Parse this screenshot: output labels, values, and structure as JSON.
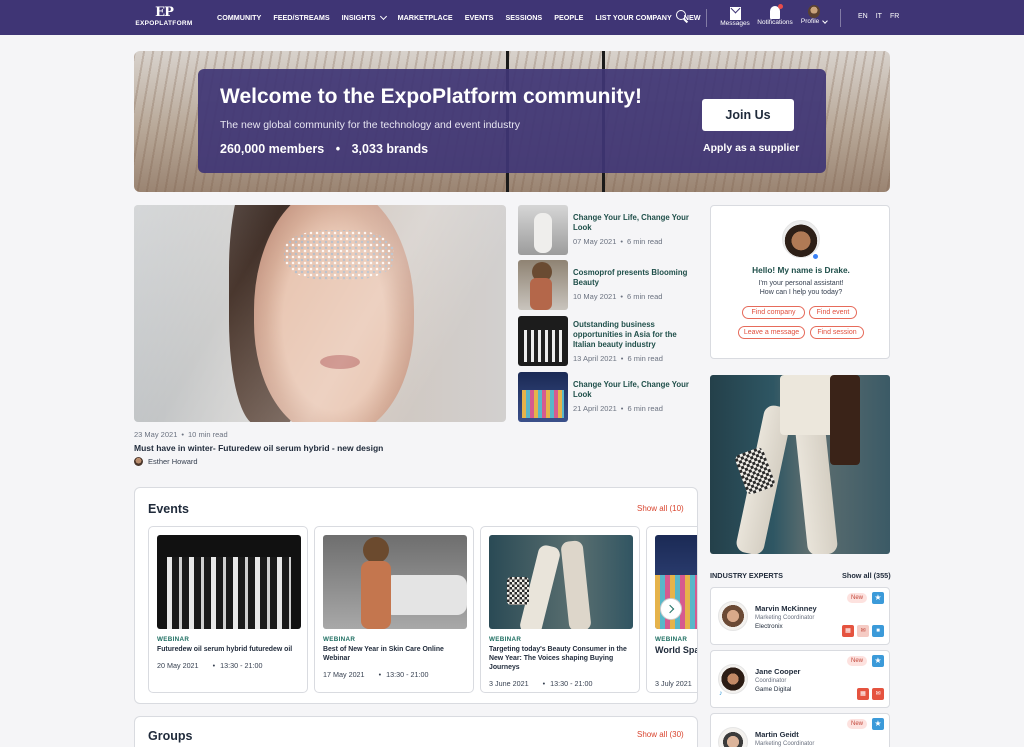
{
  "nav": {
    "logo_mark": "EP",
    "logo_text": "EXPOPLATFORM",
    "menu": [
      "COMMUNITY",
      "FEED/STREAMS",
      "INSIGHTS",
      "MARKETPLACE",
      "EVENTS",
      "SESSIONS",
      "PEOPLE",
      "LIST YOUR COMPANY",
      "NEW"
    ],
    "messages": "Messages",
    "notifications": "Notifications",
    "profile": "Profile",
    "langs": [
      "EN",
      "IT",
      "FR"
    ]
  },
  "hero": {
    "title": "Welcome to the ExpoPlatform community!",
    "subtitle": "The new global community for the technology and event industry",
    "members": "260,000 members",
    "brands": "3,033 brands",
    "join": "Join Us",
    "supplier": "Apply as a supplier"
  },
  "featured": {
    "date": "23 May 2021",
    "read": "10 min read",
    "title": "Must have in winter- Futuredew oil serum hybrid - new design",
    "author": "Esther Howard"
  },
  "articles": [
    {
      "title": "Change Your Life, Change Your Look",
      "date": "07 May 2021",
      "read": "6 min read"
    },
    {
      "title": "Cosmoprof presents Blooming Beauty",
      "date": "10 May 2021",
      "read": "6 min read"
    },
    {
      "title": "Outstanding business opportunities in Asia for the Italian beauty industry",
      "date": "13 April 2021",
      "read": "6 min read"
    },
    {
      "title": "Change Your Life, Change Your Look",
      "date": "21 April 2021",
      "read": "6 min read"
    }
  ],
  "assistant": {
    "hello": "Hello! My name is Drake.",
    "line1": "I'm your personal assistant!",
    "line2": "How can I help you today?",
    "find_company": "Find company",
    "find_event": "Find event",
    "leave_message": "Leave a message",
    "find_session": "Find session"
  },
  "experts": {
    "title": "INDUSTRY EXPERTS",
    "show_all": "Show all (355)",
    "new_label": "New",
    "items": [
      {
        "name": "Marvin McKinney",
        "role": "Marketing Coordinator",
        "company": "Electronix"
      },
      {
        "name": "Jane Cooper",
        "role": "Coordinator",
        "company": "Game Digital"
      },
      {
        "name": "Martin Geidt",
        "role": "Marketing Coordinator"
      }
    ]
  },
  "events": {
    "title": "Events",
    "show_all": "Show all (10)",
    "items": [
      {
        "type": "WEBINAR",
        "title": "Futuredew oil serum hybrid futuredew oil",
        "date": "20 May 2021",
        "time": "13:30 - 21:00"
      },
      {
        "type": "WEBINAR",
        "title": "Best of New Year in Skin Care Online Webinar",
        "date": "17 May 2021",
        "time": "13:30 - 21:00"
      },
      {
        "type": "WEBINAR",
        "title": "Targeting today's Beauty Consumer in the New Year: The Voices shaping Buying Journeys",
        "date": "3 June 2021",
        "time": "13:30 - 21:00"
      },
      {
        "type": "WEBINAR",
        "title": "World Spa Conference",
        "date": "3 July 2021"
      }
    ]
  },
  "groups": {
    "title": "Groups",
    "show_all": "Show all (30)"
  },
  "colors": {
    "brand": "#3f3575",
    "accent_red": "#d9452f",
    "accent_teal": "#1f6f62",
    "accent_blue": "#3b9ad9"
  }
}
